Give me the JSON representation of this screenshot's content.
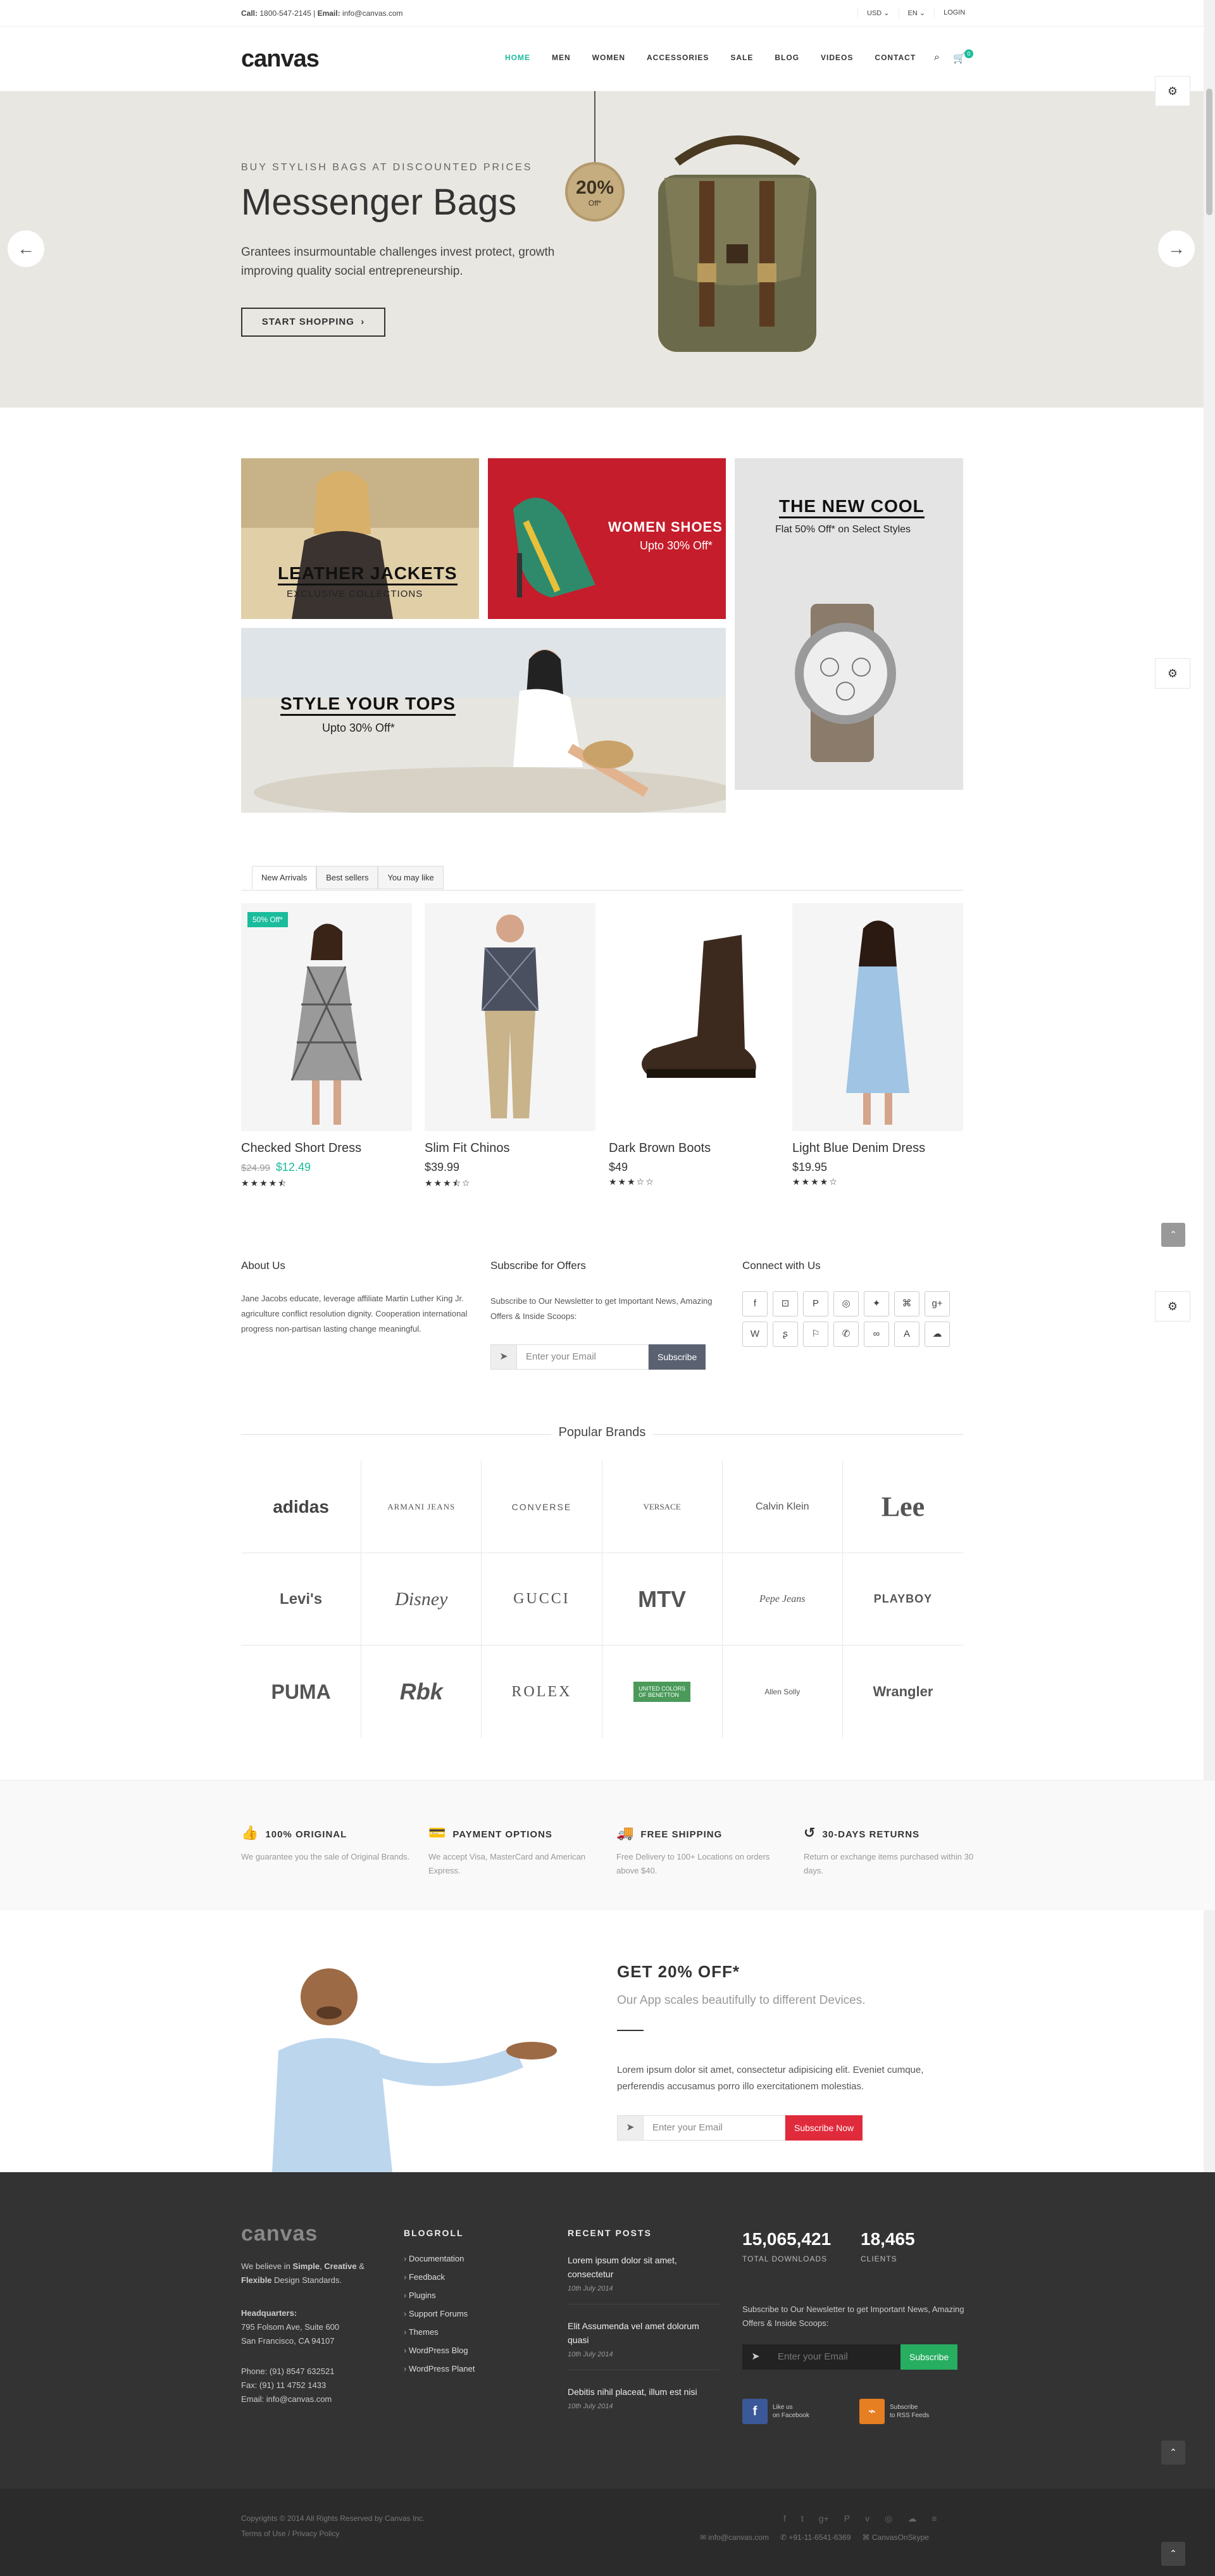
{
  "topbar": {
    "call_label": "Call:",
    "call": "1800-547-2145",
    "sep": "|",
    "email_label": "Email:",
    "email": "info@canvas.com",
    "currency": "USD",
    "language": "EN",
    "login": "LOGIN"
  },
  "header": {
    "logo": "canvas",
    "nav": [
      "HOME",
      "MEN",
      "WOMEN",
      "ACCESSORIES",
      "SALE",
      "BLOG",
      "VIDEOS",
      "CONTACT"
    ],
    "cart_count": "0"
  },
  "hero": {
    "eyebrow": "BUY STYLISH BAGS AT DISCOUNTED PRICES",
    "title": "Messenger Bags",
    "description": "Grantees insurmountable challenges invest protect, growth improving quality social entrepreneurship.",
    "cta": "START SHOPPING",
    "tag_percent": "20%",
    "tag_off": "Off*"
  },
  "promos": {
    "jackets_title": "LEATHER JACKETS",
    "jackets_sub": "EXCLUSIVE COLLECTIONS",
    "shoes_title": "WOMEN SHOES",
    "shoes_sub": "Upto 30% Off*",
    "cool_title": "THE NEW COOL",
    "cool_sub": "Flat 50% Off* on Select Styles",
    "tops_title": "STYLE YOUR TOPS",
    "tops_sub": "Upto 30% Off*"
  },
  "tabs": [
    "New Arrivals",
    "Best sellers",
    "You may like"
  ],
  "products": [
    {
      "name": "Checked Short Dress",
      "old_price": "$24.99",
      "price": "$12.49",
      "stars": "★★★★⯪",
      "badge": "50% Off*"
    },
    {
      "name": "Slim Fit Chinos",
      "old_price": "",
      "price": "$39.99",
      "stars": "★★★⯪☆",
      "badge": ""
    },
    {
      "name": "Dark Brown Boots",
      "old_price": "",
      "price": "$49",
      "stars": "★★★☆☆",
      "badge": ""
    },
    {
      "name": "Light Blue Denim Dress",
      "old_price": "",
      "price": "$19.95",
      "stars": "★★★★☆",
      "badge": ""
    }
  ],
  "about": {
    "title": "About Us",
    "text": "Jane Jacobs educate, leverage affiliate Martin Luther King Jr. agriculture conflict resolution dignity. Cooperation international progress non-partisan lasting change meaningful."
  },
  "subscribe": {
    "title": "Subscribe for Offers",
    "text": "Subscribe to Our Newsletter to get Important News, Amazing Offers & Inside Scoops:",
    "placeholder": "Enter your Email",
    "button": "Subscribe"
  },
  "connect": {
    "title": "Connect with Us",
    "icons": [
      "f",
      "⊡",
      "P",
      "◎",
      "✦",
      "⌘",
      "g+",
      "W",
      "ʂ",
      "⚐",
      "✆",
      "∞",
      "A",
      "☁"
    ]
  },
  "brands": {
    "title": "Popular Brands",
    "items": [
      "adidas",
      "ARMANI JEANS",
      "CONVERSE",
      "VERSACE",
      "Calvin Klein",
      "Lee",
      "Levi's",
      "Disney",
      "GUCCI",
      "MTV",
      "Pepe Jeans",
      "PLAYBOY",
      "PUMA",
      "Rbk",
      "ROLEX",
      "UNITED COLORS OF BENETTON",
      "Allen Solly",
      "Wrangler"
    ]
  },
  "features": [
    {
      "icon": "👍",
      "title": "100% ORIGINAL",
      "text": "We guarantee you the sale of Original Brands."
    },
    {
      "icon": "💳",
      "title": "PAYMENT OPTIONS",
      "text": "We accept Visa, MasterCard and American Express."
    },
    {
      "icon": "🚚",
      "title": "FREE SHIPPING",
      "text": "Free Delivery to 100+ Locations on orders above $40."
    },
    {
      "icon": "↺",
      "title": "30-DAYS RETURNS",
      "text": "Return or exchange items purchased within 30 days."
    }
  ],
  "app_promo": {
    "title": "GET 20% OFF*",
    "subtitle": "Our App scales beautifully to different Devices.",
    "text": "Lorem ipsum dolor sit amet, consectetur adipisicing elit. Eveniet cumque, perferendis accusamus porro illo exercitationem molestias.",
    "placeholder": "Enter your Email",
    "button": "Subscribe Now"
  },
  "footer": {
    "logo": "canvas",
    "about_prefix": "We believe in",
    "about_strong1": "Simple",
    "about_strong2": "Creative",
    "about_strong3": "Flexible",
    "about_suffix": "Design Standards.",
    "hq_label": "Headquarters:",
    "address1": "795 Folsom Ave, Suite 600",
    "address2": "San Francisco, CA 94107",
    "phone": "Phone: (91) 8547 632521",
    "fax": "Fax: (91) 11 4752 1433",
    "email": "Email: info@canvas.com",
    "blogroll_title": "BLOGROLL",
    "blogroll": [
      "Documentation",
      "Feedback",
      "Plugins",
      "Support Forums",
      "Themes",
      "WordPress Blog",
      "WordPress Planet"
    ],
    "posts_title": "RECENT POSTS",
    "posts": [
      {
        "title": "Lorem ipsum dolor sit amet, consectetur",
        "date": "10th July 2014"
      },
      {
        "title": "Elit Assumenda vel amet dolorum quasi",
        "date": "10th July 2014"
      },
      {
        "title": "Debitis nihil placeat, illum est nisi",
        "date": "10th July 2014"
      }
    ],
    "downloads": "15,065,421",
    "downloads_label": "TOTAL DOWNLOADS",
    "clients": "18,465",
    "clients_label": "CLIENTS",
    "newsletter_text": "Subscribe to Our Newsletter to get Important News, Amazing Offers & Inside Scoops:",
    "placeholder": "Enter your Email",
    "button": "Subscribe",
    "fb_line1": "Like us",
    "fb_line2": "on Facebook",
    "rss_line1": "Subscribe",
    "rss_line2": "to RSS Feeds"
  },
  "copyright": {
    "text": "Copyrights © 2014 All Rights Reserved by Canvas Inc.",
    "terms": "Terms of Use",
    "divider": "/",
    "privacy": "Privacy Policy",
    "email": "✉ info@canvas.com",
    "phone": "✆ +91-11-6541-6369",
    "skype": "⌘ CanvasOnSkype",
    "icons": [
      "f",
      "t",
      "g+",
      "P",
      "v",
      "◎",
      "☁",
      "≡"
    ]
  },
  "colors": {
    "accent": "#1abc9c",
    "red": "#e74c3c",
    "green": "#27ae60",
    "footer": "#333333",
    "subscribe_btn": "#5a6271"
  }
}
